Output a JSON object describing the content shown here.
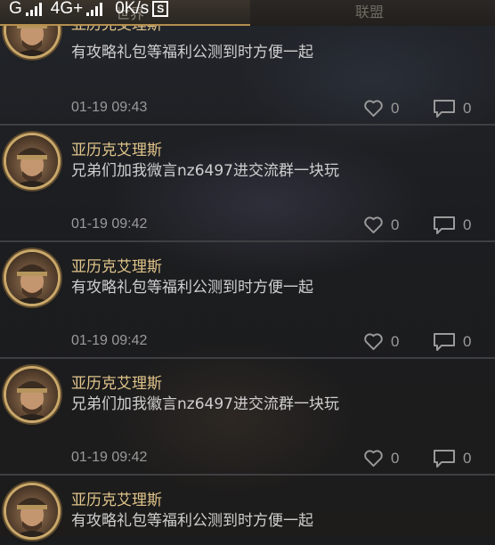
{
  "status_bar": {
    "network_left": "G",
    "network_right": "4G+",
    "speed": "0K/s",
    "badge": "S"
  },
  "tabs": [
    {
      "label": "世界",
      "active": true
    },
    {
      "label": "联盟",
      "active": false
    }
  ],
  "icons": {
    "like": "heart-outline-icon",
    "comment": "speech-bubble-icon"
  },
  "colors": {
    "accent_gold": "#b58f4e",
    "username": "#e0c48a"
  },
  "posts": [
    {
      "username": "亚历克艾理斯",
      "message": "有攻略礼包等福利公测到时方便一起",
      "time": "01-19 09:43",
      "likes": "0",
      "comments": "0"
    },
    {
      "username": "亚历克艾理斯",
      "message": "兄弟们加我微言nz6497进交流群一块玩",
      "time": "01-19 09:42",
      "likes": "0",
      "comments": "0"
    },
    {
      "username": "亚历克艾理斯",
      "message": "有攻略礼包等福利公测到时方便一起",
      "time": "01-19 09:42",
      "likes": "0",
      "comments": "0"
    },
    {
      "username": "亚历克艾理斯",
      "message": "兄弟们加我徽言nz6497进交流群一块玩",
      "time": "01-19 09:42",
      "likes": "0",
      "comments": "0"
    },
    {
      "username": "亚历克艾理斯",
      "message": "有攻略礼包等福利公测到时方便一起",
      "time": "",
      "likes": "",
      "comments": ""
    }
  ]
}
